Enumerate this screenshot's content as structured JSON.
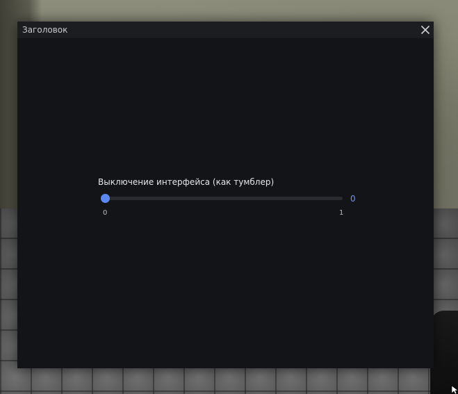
{
  "window": {
    "title": "Заголовок"
  },
  "slider": {
    "label": "Выключение интерфейса (как тумблер)",
    "min": 0,
    "max": 1,
    "value": 0,
    "value_text": "0",
    "min_text": "0",
    "max_text": "1",
    "accent_color": "#5b89f0"
  },
  "icons": {
    "close": "close-icon"
  }
}
